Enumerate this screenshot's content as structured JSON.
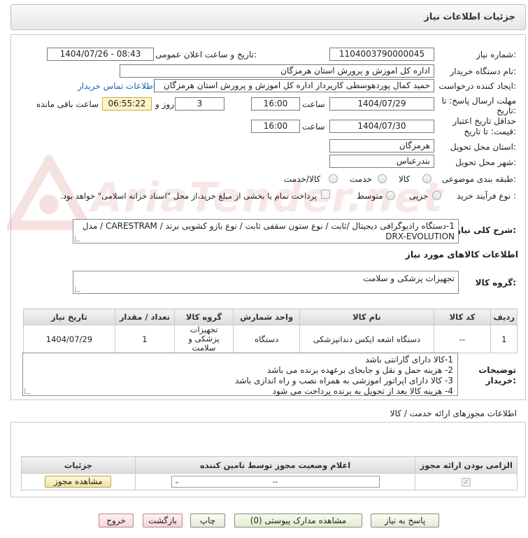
{
  "header": {
    "title": "جزئیات اطلاعات نیاز"
  },
  "watermark": {
    "text": "AriaTender.net"
  },
  "need_number": {
    "label": "شماره نیاز:",
    "value": "1104003790000045"
  },
  "announce_datetime": {
    "label": "تاریخ و ساعت اعلان عمومی:",
    "value": "1404/07/26 - 08:43"
  },
  "buyer_org": {
    "label": "نام دستگاه خریدار:",
    "value": "اداره کل اموزش و پرورش استان هرمزگان"
  },
  "requester": {
    "label": "ایجاد کننده درخواست:",
    "value": "حمید کمال پوردهوسطی کارپرداز اداره کل اموزش و پرورش استان هرمزگان",
    "contact_link": "اطلاعات تماس خریدار"
  },
  "reply_deadline": {
    "label1": "مهلت ارسال پاسخ: تا",
    "label2": "تاریخ:",
    "date": "1404/07/29",
    "time_label": "ساعت",
    "time": "16:00",
    "days": "3",
    "days_label": "روز و",
    "remaining": "06:55:22",
    "remaining_label": "ساعت باقی مانده"
  },
  "price_validity": {
    "label1": "حداقل تاریخ اعتبار",
    "label2": "قیمت: تا تاریخ:",
    "date": "1404/07/30",
    "time_label": "ساعت",
    "time": "16:00"
  },
  "province": {
    "label": "استان محل تحویل:",
    "value": "هرمزگان"
  },
  "city": {
    "label": "شهر محل تحویل:",
    "value": "بندرعباس"
  },
  "category": {
    "label": "طبقه بندی موضوعی:",
    "options": [
      "کالا",
      "خدمت",
      "کالا/خدمت"
    ]
  },
  "purchase_type": {
    "label": "نوع فرآیند خرید :",
    "options": [
      "جزیی",
      "متوسط"
    ],
    "payment_note": "پرداخت تمام یا بخشی از مبلغ خرید،از محل \"اسناد خزانه اسلامی\" خواهد بود."
  },
  "description": {
    "label": "شرح کلی نیاز:",
    "value": "1-دستگاه رادیوگرافی دیجیتال /ثابت / نوع ستون سقفی ثابت / نوع بازو کشویی برند / CARESTRAM / مدل DRX-EVOLUTION"
  },
  "goods_section": {
    "title": "اطلاعات کالاهای مورد نیاز"
  },
  "goods_group": {
    "label": "گروه کالا:",
    "value": "تجهیزات پزشکی و سلامت"
  },
  "items_table": {
    "headers": [
      "ردیف",
      "کد کالا",
      "نام کالا",
      "واحد شمارش",
      "گروه کالا",
      "تعداد / مقدار",
      "تاریخ نیاز"
    ],
    "rows": [
      [
        "1",
        "--",
        "دستگاه اشعه ایکس دندانپزشکی",
        "دستگاه",
        "تجهیزات پزشکی و سلامت",
        "1",
        "1404/07/29"
      ]
    ]
  },
  "buyer_notes": {
    "label1": "توضیحات",
    "label2": "خریدار:",
    "lines": [
      "1-کالا دارای گارانتی باشد",
      "2- هزینه حمل و نقل و جابجای برعهده برنده می باشد",
      "3- کالا دارای اپراتور اموزشی به همراه نصب و راه اندازی باشد",
      "4- هزینه کالا بعد از تحویل به برنده پرداخت می شود"
    ]
  },
  "permits": {
    "title": "اطلاعات مجوزهای ارائه خدمت / کالا",
    "headers": [
      "الزامی بودن ارائه مجوز",
      "اعلام وضعیت مجوز توسط تامین کننده",
      "جزئیات"
    ],
    "select_value": "--",
    "view_button": "مشاهده مجوز"
  },
  "actions": {
    "reply": "پاسخ به نیاز",
    "view_docs": "مشاهده مدارک پیوستی (0)",
    "print": "چاپ",
    "back": "بازگشت",
    "exit": "خروج"
  }
}
